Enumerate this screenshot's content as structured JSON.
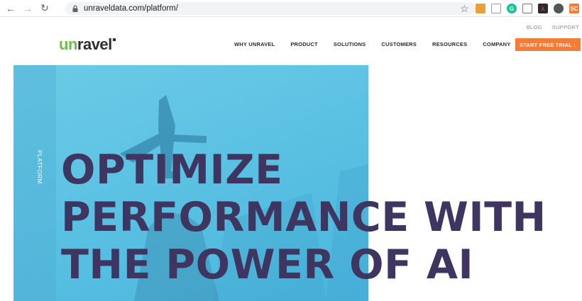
{
  "browser": {
    "url": "unraveldata.com/platform/",
    "extensions": [
      "ghost-extension-icon",
      "tools-extension-icon",
      "grammarly-icon",
      "bookmark-extension-icon",
      "pdf-icon",
      "circle-extension-icon",
      "sc-extension-icon"
    ],
    "sc_label": "SC"
  },
  "utility_nav": [
    "BLOG",
    "SUPPORT"
  ],
  "logo": {
    "prefix": "un",
    "suffix": "ravel"
  },
  "main_nav": [
    "WHY UNRAVEL",
    "PRODUCT",
    "SOLUTIONS",
    "CUSTOMERS",
    "RESOURCES",
    "COMPANY"
  ],
  "cta": {
    "label": "START FREE TRIAL ↓"
  },
  "hero": {
    "section_label": "PLATFORM",
    "headline": [
      "OPTIMIZE",
      "PERFORMANCE WITH",
      "THE POWER OF AI"
    ]
  },
  "colors": {
    "accent": "#f47b38",
    "headline": "#3e3561",
    "hero_bg": "#5cc2e3",
    "logo_green": "#6bbf4d"
  }
}
